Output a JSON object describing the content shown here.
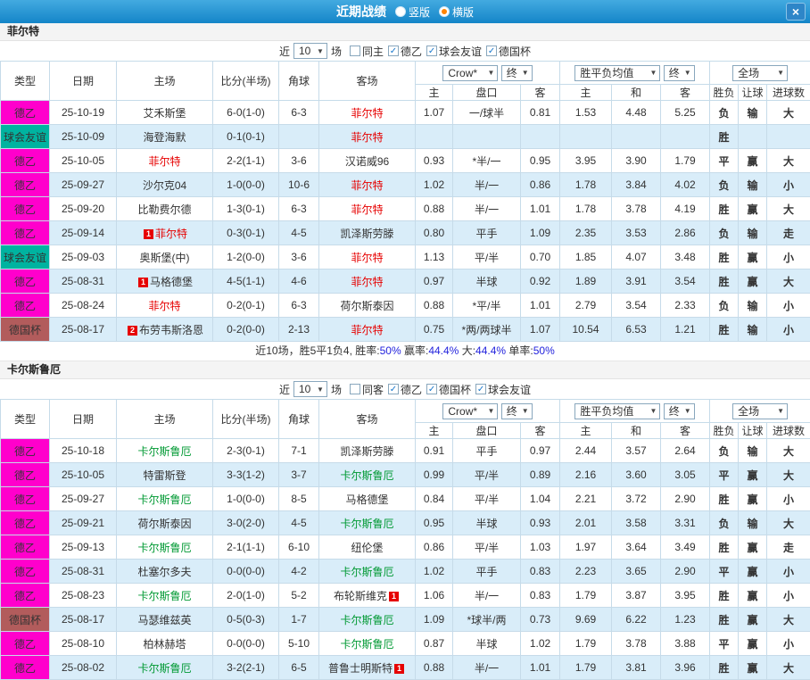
{
  "titlebar": {
    "title": "近期战绩",
    "radios": [
      {
        "label": "竖版",
        "selected": false
      },
      {
        "label": "横版",
        "selected": true
      }
    ]
  },
  "icons": {
    "chevron_down": "▼",
    "close": "×",
    "check": "✓"
  },
  "colors": {
    "accent_blue": "#1f8ccb",
    "league_magenta": "#ff00cc",
    "friendly_teal": "#00b3a0",
    "cup_maroon": "#b25c5c",
    "win_red": "#e60000",
    "lose_green": "#009933",
    "draw_blue": "#3333cc",
    "row_alt_blue": "#d9edf9"
  },
  "columns": {
    "type": "类型",
    "date": "日期",
    "home": "主场",
    "score": "比分(半场)",
    "corner": "角球",
    "away": "客场",
    "asia_home": "主",
    "asia_handicap": "盘口",
    "asia_away": "客",
    "eu_home": "主",
    "eu_draw": "和",
    "eu_away": "客",
    "result": "胜负",
    "handicap_result": "让球",
    "goals": "进球数",
    "bookmaker_select": "Crow*",
    "final_select": "终",
    "wdl_select": "胜平负均值",
    "scope_select": "全场"
  },
  "sections": [
    {
      "team": "菲尔特",
      "team_color": "#e60000",
      "filter": {
        "near_label": "近",
        "count": "10",
        "games_label": "场",
        "checkboxes": [
          {
            "label": "同主",
            "checked": false
          },
          {
            "label": "德乙",
            "checked": true
          },
          {
            "label": "球会友谊",
            "checked": true
          },
          {
            "label": "德国杯",
            "checked": true
          }
        ]
      },
      "rows": [
        {
          "type": "德乙",
          "date": "25-10-19",
          "home": "艾禾斯堡",
          "hbadge": "",
          "home_self": false,
          "score": "6-0(1-0)",
          "corner": "6-3",
          "away": "菲尔特",
          "abadge": "",
          "away_self": true,
          "a1": "1.07",
          "hc": "一/球半",
          "a2": "0.81",
          "e1": "1.53",
          "ed": "4.48",
          "e2": "5.25",
          "res": "负",
          "hres": "输",
          "gres": "大"
        },
        {
          "type": "球会友谊",
          "date": "25-10-09",
          "home": "海登海默",
          "hbadge": "",
          "home_self": false,
          "score": "0-1(0-1)",
          "corner": "",
          "away": "菲尔特",
          "abadge": "",
          "away_self": true,
          "a1": "",
          "hc": "",
          "a2": "",
          "e1": "",
          "ed": "",
          "e2": "",
          "res": "胜",
          "hres": "",
          "gres": ""
        },
        {
          "type": "德乙",
          "date": "25-10-05",
          "home": "菲尔特",
          "hbadge": "",
          "home_self": true,
          "score": "2-2(1-1)",
          "corner": "3-6",
          "away": "汉诺威96",
          "abadge": "",
          "away_self": false,
          "a1": "0.93",
          "hc": "*半/一",
          "a2": "0.95",
          "e1": "3.95",
          "ed": "3.90",
          "e2": "1.79",
          "res": "平",
          "hres": "赢",
          "gres": "大"
        },
        {
          "type": "德乙",
          "date": "25-09-27",
          "home": "沙尔克04",
          "hbadge": "",
          "home_self": false,
          "score": "1-0(0-0)",
          "corner": "10-6",
          "away": "菲尔特",
          "abadge": "",
          "away_self": true,
          "a1": "1.02",
          "hc": "半/一",
          "a2": "0.86",
          "e1": "1.78",
          "ed": "3.84",
          "e2": "4.02",
          "res": "负",
          "hres": "输",
          "gres": "小"
        },
        {
          "type": "德乙",
          "date": "25-09-20",
          "home": "比勒费尔德",
          "hbadge": "",
          "home_self": false,
          "score": "1-3(0-1)",
          "corner": "6-3",
          "away": "菲尔特",
          "abadge": "",
          "away_self": true,
          "a1": "0.88",
          "hc": "半/一",
          "a2": "1.01",
          "e1": "1.78",
          "ed": "3.78",
          "e2": "4.19",
          "res": "胜",
          "hres": "赢",
          "gres": "大"
        },
        {
          "type": "德乙",
          "date": "25-09-14",
          "home": "菲尔特",
          "hbadge": "1",
          "home_self": true,
          "score": "0-3(0-1)",
          "corner": "4-5",
          "away": "凯泽斯劳滕",
          "abadge": "",
          "away_self": false,
          "a1": "0.80",
          "hc": "平手",
          "a2": "1.09",
          "e1": "2.35",
          "ed": "3.53",
          "e2": "2.86",
          "res": "负",
          "hres": "输",
          "gres": "走"
        },
        {
          "type": "球会友谊",
          "date": "25-09-03",
          "home": "奥斯堡(中)",
          "hbadge": "",
          "home_self": false,
          "score": "1-2(0-0)",
          "corner": "3-6",
          "away": "菲尔特",
          "abadge": "",
          "away_self": true,
          "a1": "1.13",
          "hc": "平/半",
          "a2": "0.70",
          "e1": "1.85",
          "ed": "4.07",
          "e2": "3.48",
          "res": "胜",
          "hres": "赢",
          "gres": "小"
        },
        {
          "type": "德乙",
          "date": "25-08-31",
          "home": "马格德堡",
          "hbadge": "1",
          "home_self": false,
          "score": "4-5(1-1)",
          "corner": "4-6",
          "away": "菲尔特",
          "abadge": "",
          "away_self": true,
          "a1": "0.97",
          "hc": "半球",
          "a2": "0.92",
          "e1": "1.89",
          "ed": "3.91",
          "e2": "3.54",
          "res": "胜",
          "hres": "赢",
          "gres": "大"
        },
        {
          "type": "德乙",
          "date": "25-08-24",
          "home": "菲尔特",
          "hbadge": "",
          "home_self": true,
          "score": "0-2(0-1)",
          "corner": "6-3",
          "away": "荷尔斯泰因",
          "abadge": "",
          "away_self": false,
          "a1": "0.88",
          "hc": "*平/半",
          "a2": "1.01",
          "e1": "2.79",
          "ed": "3.54",
          "e2": "2.33",
          "res": "负",
          "hres": "输",
          "gres": "小"
        },
        {
          "type": "德国杯",
          "date": "25-08-17",
          "home": "布劳韦斯洛恩",
          "hbadge": "2",
          "home_self": false,
          "score": "0-2(0-0)",
          "corner": "2-13",
          "away": "菲尔特",
          "abadge": "",
          "away_self": true,
          "a1": "0.75",
          "hc": "*两/两球半",
          "a2": "1.07",
          "e1": "10.54",
          "ed": "6.53",
          "e2": "1.21",
          "res": "胜",
          "hres": "输",
          "gres": "小"
        }
      ],
      "summary": [
        {
          "text": "近10场，胜5平1负4, ",
          "style": "plain"
        },
        {
          "text": "胜率:",
          "style": "plain"
        },
        {
          "text": "50%",
          "style": "blue"
        },
        {
          "text": " 赢率:",
          "style": "plain"
        },
        {
          "text": "44.4%",
          "style": "blue"
        },
        {
          "text": " 大:",
          "style": "plain"
        },
        {
          "text": "44.4%",
          "style": "blue"
        },
        {
          "text": " 单率:",
          "style": "plain"
        },
        {
          "text": "50%",
          "style": "blue"
        }
      ]
    },
    {
      "team": "卡尔斯鲁厄",
      "team_color": "#009933",
      "filter": {
        "near_label": "近",
        "count": "10",
        "games_label": "场",
        "checkboxes": [
          {
            "label": "同客",
            "checked": false
          },
          {
            "label": "德乙",
            "checked": true
          },
          {
            "label": "德国杯",
            "checked": true
          },
          {
            "label": "球会友谊",
            "checked": true
          }
        ]
      },
      "rows": [
        {
          "type": "德乙",
          "date": "25-10-18",
          "home": "卡尔斯鲁厄",
          "hbadge": "",
          "home_self": true,
          "score": "2-3(0-1)",
          "corner": "7-1",
          "away": "凯泽斯劳滕",
          "abadge": "",
          "away_self": false,
          "a1": "0.91",
          "hc": "平手",
          "a2": "0.97",
          "e1": "2.44",
          "ed": "3.57",
          "e2": "2.64",
          "res": "负",
          "hres": "输",
          "gres": "大"
        },
        {
          "type": "德乙",
          "date": "25-10-05",
          "home": "特雷斯登",
          "hbadge": "",
          "home_self": false,
          "score": "3-3(1-2)",
          "corner": "3-7",
          "away": "卡尔斯鲁厄",
          "abadge": "",
          "away_self": true,
          "a1": "0.99",
          "hc": "平/半",
          "a2": "0.89",
          "e1": "2.16",
          "ed": "3.60",
          "e2": "3.05",
          "res": "平",
          "hres": "赢",
          "gres": "大"
        },
        {
          "type": "德乙",
          "date": "25-09-27",
          "home": "卡尔斯鲁厄",
          "hbadge": "",
          "home_self": true,
          "score": "1-0(0-0)",
          "corner": "8-5",
          "away": "马格德堡",
          "abadge": "",
          "away_self": false,
          "a1": "0.84",
          "hc": "平/半",
          "a2": "1.04",
          "e1": "2.21",
          "ed": "3.72",
          "e2": "2.90",
          "res": "胜",
          "hres": "赢",
          "gres": "小"
        },
        {
          "type": "德乙",
          "date": "25-09-21",
          "home": "荷尔斯泰因",
          "hbadge": "",
          "home_self": false,
          "score": "3-0(2-0)",
          "corner": "4-5",
          "away": "卡尔斯鲁厄",
          "abadge": "",
          "away_self": true,
          "a1": "0.95",
          "hc": "半球",
          "a2": "0.93",
          "e1": "2.01",
          "ed": "3.58",
          "e2": "3.31",
          "res": "负",
          "hres": "输",
          "gres": "大"
        },
        {
          "type": "德乙",
          "date": "25-09-13",
          "home": "卡尔斯鲁厄",
          "hbadge": "",
          "home_self": true,
          "score": "2-1(1-1)",
          "corner": "6-10",
          "away": "纽伦堡",
          "abadge": "",
          "away_self": false,
          "a1": "0.86",
          "hc": "平/半",
          "a2": "1.03",
          "e1": "1.97",
          "ed": "3.64",
          "e2": "3.49",
          "res": "胜",
          "hres": "赢",
          "gres": "走"
        },
        {
          "type": "德乙",
          "date": "25-08-31",
          "home": "杜塞尔多夫",
          "hbadge": "",
          "home_self": false,
          "score": "0-0(0-0)",
          "corner": "4-2",
          "away": "卡尔斯鲁厄",
          "abadge": "",
          "away_self": true,
          "a1": "1.02",
          "hc": "平手",
          "a2": "0.83",
          "e1": "2.23",
          "ed": "3.65",
          "e2": "2.90",
          "res": "平",
          "hres": "赢",
          "gres": "小"
        },
        {
          "type": "德乙",
          "date": "25-08-23",
          "home": "卡尔斯鲁厄",
          "hbadge": "",
          "home_self": true,
          "score": "2-0(1-0)",
          "corner": "5-2",
          "away": "布轮斯维克",
          "abadge": "1",
          "away_self": false,
          "a1": "1.06",
          "hc": "半/一",
          "a2": "0.83",
          "e1": "1.79",
          "ed": "3.87",
          "e2": "3.95",
          "res": "胜",
          "hres": "赢",
          "gres": "小"
        },
        {
          "type": "德国杯",
          "date": "25-08-17",
          "home": "马瑟维兹英",
          "hbadge": "",
          "home_self": false,
          "score": "0-5(0-3)",
          "corner": "1-7",
          "away": "卡尔斯鲁厄",
          "abadge": "",
          "away_self": true,
          "a1": "1.09",
          "hc": "*球半/两",
          "a2": "0.73",
          "e1": "9.69",
          "ed": "6.22",
          "e2": "1.23",
          "res": "胜",
          "hres": "赢",
          "gres": "大"
        },
        {
          "type": "德乙",
          "date": "25-08-10",
          "home": "柏林赫塔",
          "hbadge": "",
          "home_self": false,
          "score": "0-0(0-0)",
          "corner": "5-10",
          "away": "卡尔斯鲁厄",
          "abadge": "",
          "away_self": true,
          "a1": "0.87",
          "hc": "半球",
          "a2": "1.02",
          "e1": "1.79",
          "ed": "3.78",
          "e2": "3.88",
          "res": "平",
          "hres": "赢",
          "gres": "小"
        },
        {
          "type": "德乙",
          "date": "25-08-02",
          "home": "卡尔斯鲁厄",
          "hbadge": "",
          "home_self": true,
          "score": "3-2(2-1)",
          "corner": "6-5",
          "away": "普鲁士明斯特",
          "abadge": "1",
          "away_self": false,
          "a1": "0.88",
          "hc": "半/一",
          "a2": "1.01",
          "e1": "1.79",
          "ed": "3.81",
          "e2": "3.96",
          "res": "胜",
          "hres": "赢",
          "gres": "大"
        }
      ],
      "summary": []
    }
  ]
}
